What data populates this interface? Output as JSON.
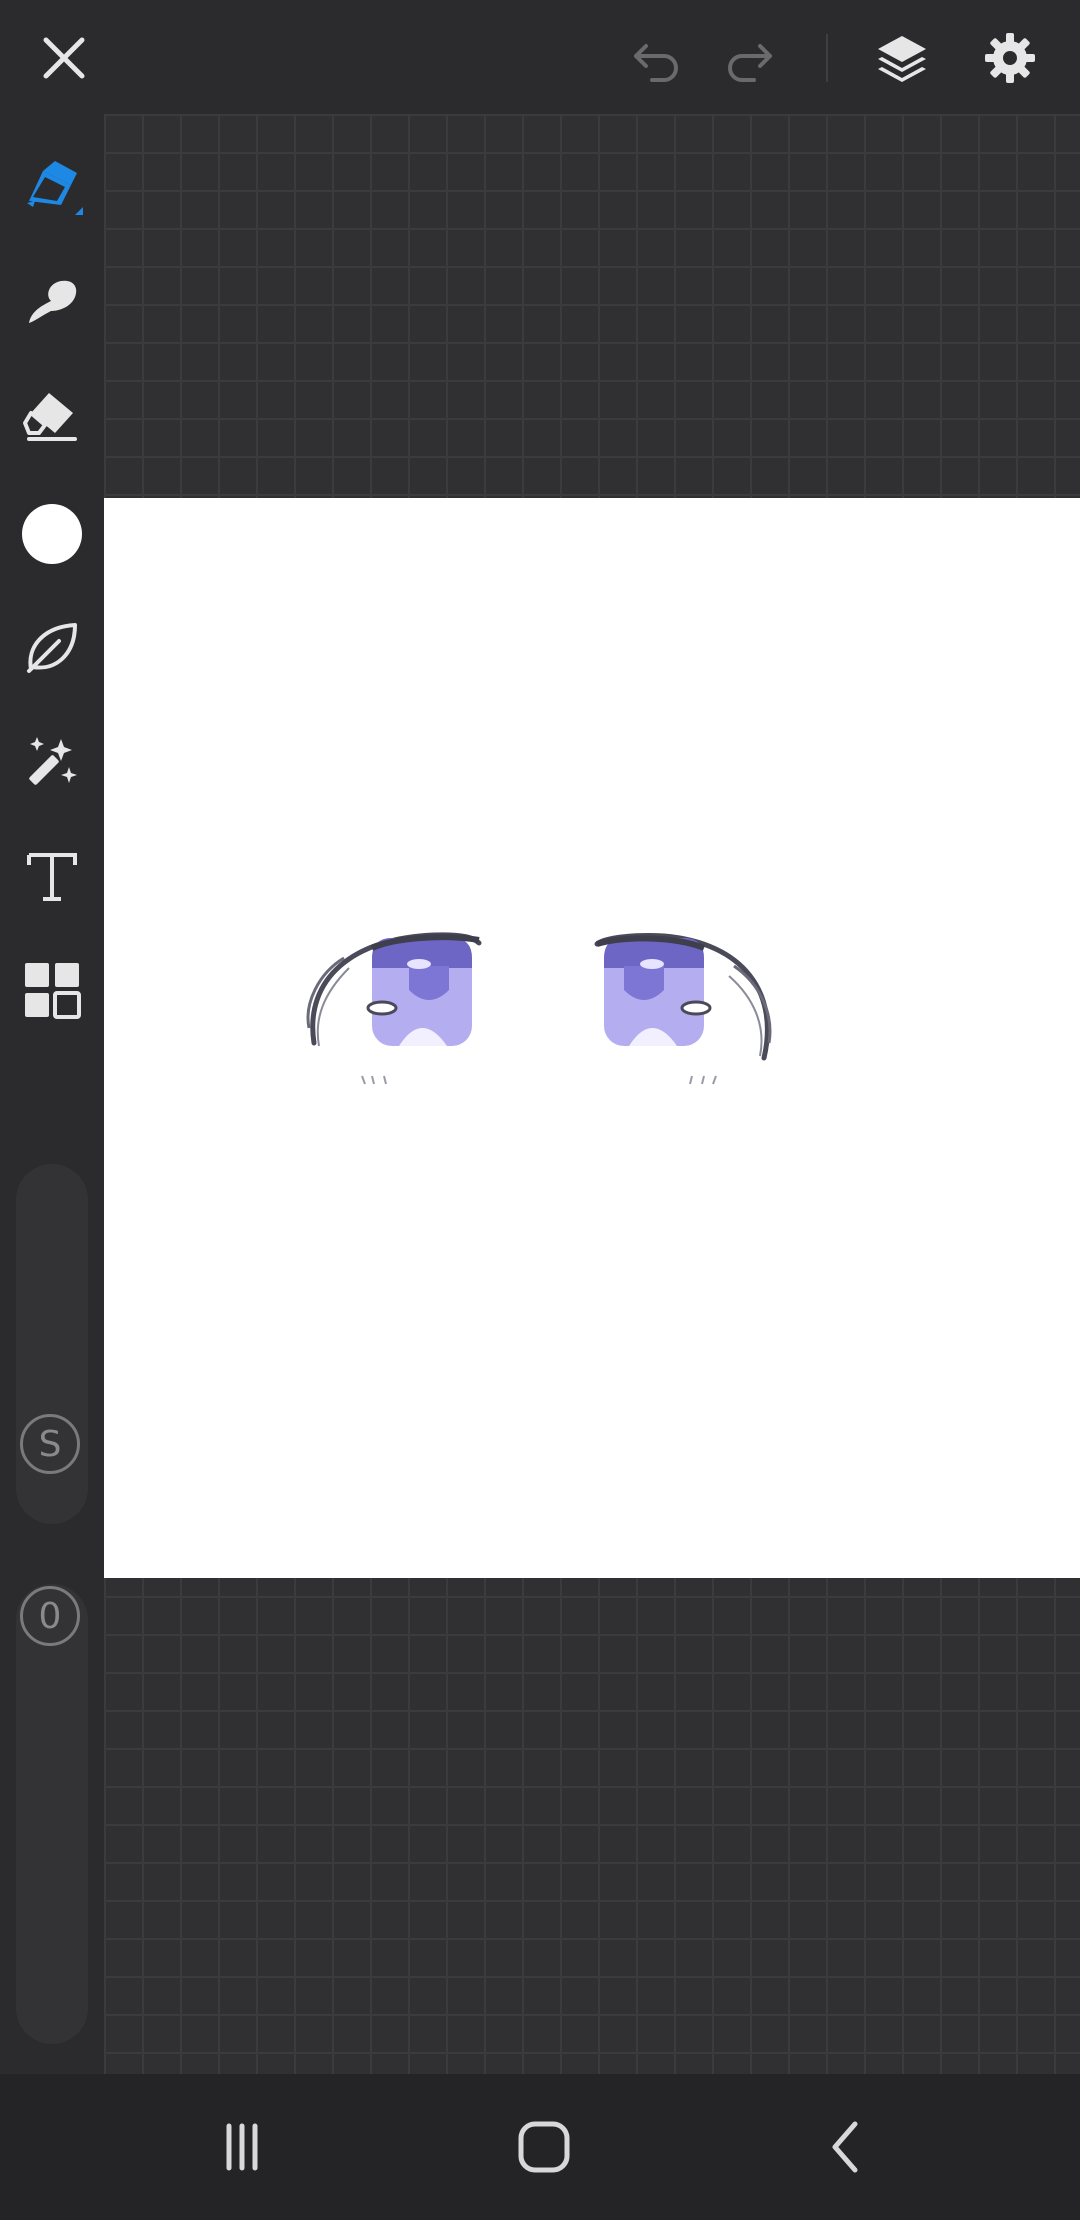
{
  "app": {
    "accent_color": "#1e88e5",
    "background_color": "#2b2b2d"
  },
  "toolbar": {
    "close_icon": "close-icon",
    "undo_icon": "undo-icon",
    "redo_icon": "redo-icon",
    "layers_icon": "layers-icon",
    "settings_icon": "gear-icon"
  },
  "tools": [
    {
      "name": "pen",
      "icon": "pen-icon",
      "selected": true
    },
    {
      "name": "smudge",
      "icon": "smudge-icon"
    },
    {
      "name": "eraser",
      "icon": "eraser-icon"
    },
    {
      "name": "color",
      "icon": "color-swatch",
      "value": "#ffffff"
    },
    {
      "name": "brush-library",
      "icon": "leaf-icon"
    },
    {
      "name": "magic",
      "icon": "magic-wand-icon"
    },
    {
      "name": "text",
      "icon": "text-icon"
    },
    {
      "name": "more",
      "icon": "grid-icon"
    }
  ],
  "sliders": {
    "size_label": "S",
    "opacity_value": "0"
  },
  "canvas": {
    "background": "#ffffff",
    "drawing": "two anime eyes"
  },
  "navbar": {
    "recent_icon": "recent-apps-icon",
    "home_icon": "home-icon",
    "back_icon": "back-icon"
  }
}
